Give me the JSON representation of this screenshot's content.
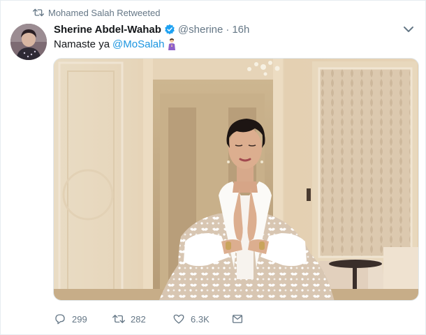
{
  "retweet_context": {
    "icon": "retweet-icon",
    "text": "Mohamed Salah Retweeted"
  },
  "author": {
    "display_name": "Sherine Abdel-Wahab",
    "verified_icon": "verified-badge-icon",
    "handle": "@sherine",
    "separator": "·",
    "time": "16h"
  },
  "tweet": {
    "text_before": "Namaste ya",
    "mention": "@MoSalah",
    "emoji": "person-with-folded-hands-emoji"
  },
  "actions": {
    "reply_count": "299",
    "retweet_count": "282",
    "like_count": "6.3K",
    "message_icon": "direct-message-icon"
  },
  "colors": {
    "link": "#1b95e0",
    "secondary_text": "#657786",
    "verified": "#1da1f2"
  }
}
